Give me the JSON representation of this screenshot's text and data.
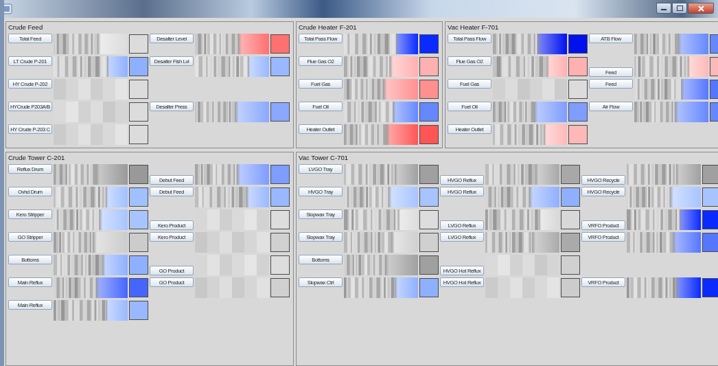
{
  "sections": [
    {
      "panels": [
        {
          "title": "Crude Feed",
          "rows": [
            {
              "cells": [
                {
                  "kind": "bars",
                  "label": "Total Feed",
                  "label_low": false,
                  "color": "#dcdcdc"
                },
                {
                  "kind": "bars",
                  "label": "Desalter Level",
                  "label_low": false,
                  "color": "#ff7070"
                }
              ]
            },
            {
              "cells": [
                {
                  "kind": "bars",
                  "label": "LT Crude P-201",
                  "label_low": false,
                  "color": "#8fb0ff"
                },
                {
                  "kind": "bars",
                  "label": "Desalter Fish Lvl",
                  "label_low": false,
                  "color": "#9ab8ff"
                }
              ]
            },
            {
              "cells": [
                {
                  "kind": "flat",
                  "label": "HY Crude P-202",
                  "label_low": false,
                  "color": "#dcdcdc"
                },
                {
                  "kind": "blank"
                }
              ]
            },
            {
              "cells": [
                {
                  "kind": "flat",
                  "label": "HYCrude P203A/B",
                  "label_low": false,
                  "color": "#dcdcdc"
                },
                {
                  "kind": "bars",
                  "label": "Desalter Press",
                  "label_low": false,
                  "color": "#8aa8ff"
                }
              ]
            },
            {
              "cells": [
                {
                  "kind": "flat",
                  "label": "HY Crude P-203 C",
                  "label_low": false,
                  "color": "#dcdcdc"
                },
                {
                  "kind": "blank"
                }
              ]
            }
          ]
        },
        {
          "title": "Crude Heater F-201",
          "rows": [
            {
              "cells": [
                {
                  "kind": "bars",
                  "label": "Total Pass Flow",
                  "label_low": false,
                  "color": "#0a2aff"
                }
              ]
            },
            {
              "cells": [
                {
                  "kind": "bars",
                  "label": "Flue Gas O2",
                  "label_low": false,
                  "color": "#ffb0b0"
                }
              ]
            },
            {
              "cells": [
                {
                  "kind": "bars",
                  "label": "Fuel Gas",
                  "label_low": false,
                  "color": "#ff9090"
                }
              ]
            },
            {
              "cells": [
                {
                  "kind": "bars",
                  "label": "Fuel Oil",
                  "label_low": false,
                  "color": "#6688ff"
                }
              ]
            },
            {
              "cells": [
                {
                  "kind": "bars",
                  "label": "Heater Outlet",
                  "label_low": false,
                  "color": "#ff5555"
                }
              ]
            }
          ]
        },
        {
          "title": "Vac Heater F-701",
          "rows": [
            {
              "cells": [
                {
                  "kind": "bars",
                  "label": "Total Pass Flow",
                  "label_low": false,
                  "color": "#0011ee"
                },
                {
                  "kind": "bars",
                  "label": "ATB Flow",
                  "label_low": false,
                  "color": "#6688ff"
                }
              ]
            },
            {
              "cells": [
                {
                  "kind": "bars",
                  "label": "Flue Gas O2",
                  "label_low": false,
                  "color": "#ffb0b0"
                },
                {
                  "kind": "bars",
                  "label": "Feed",
                  "label_low": true,
                  "color": "#ffb8b8"
                }
              ]
            },
            {
              "cells": [
                {
                  "kind": "flat",
                  "label": "Fuel Gas",
                  "label_low": false,
                  "color": "#dcdcdc"
                },
                {
                  "kind": "bars",
                  "label": "Feed",
                  "label_low": false,
                  "color": "#5577ff"
                }
              ]
            },
            {
              "cells": [
                {
                  "kind": "bars",
                  "label": "Fuel Oil",
                  "label_low": false,
                  "color": "#7f9dff"
                },
                {
                  "kind": "bars",
                  "label": "Air Flow",
                  "label_low": false,
                  "color": "#6688ff"
                }
              ]
            },
            {
              "cells": [
                {
                  "kind": "bars",
                  "label": "Heater Outlet",
                  "label_low": false,
                  "color": "#ffb8b8"
                },
                {
                  "kind": "blank"
                }
              ]
            }
          ]
        }
      ]
    },
    {
      "panels": [
        {
          "title": "Crude Tower C-201",
          "rows": [
            {
              "cells": [
                {
                  "kind": "bars",
                  "label": "Reflux Drum",
                  "label_low": false,
                  "color": "#999999"
                },
                {
                  "kind": "bars",
                  "label": "Debut Feed",
                  "label_low": true,
                  "color": "#7f9cff"
                }
              ]
            },
            {
              "cells": [
                {
                  "kind": "bars",
                  "label": "Ovhd Drum",
                  "label_low": false,
                  "color": "#a0c0ff"
                },
                {
                  "kind": "bars",
                  "label": "Debut Feed",
                  "label_low": false,
                  "color": "#9ab8ff"
                }
              ]
            },
            {
              "cells": [
                {
                  "kind": "bars",
                  "label": "Kero Stripper",
                  "label_low": false,
                  "color": "#a8c4ff"
                },
                {
                  "kind": "flat",
                  "label": "Kero Product",
                  "label_low": true,
                  "color": "#dddddd"
                }
              ]
            },
            {
              "cells": [
                {
                  "kind": "bars",
                  "label": "GO Stripper",
                  "label_low": false,
                  "color": "#cccccc"
                },
                {
                  "kind": "flat",
                  "label": "Kero Product",
                  "label_low": false,
                  "color": "#d0d0d0"
                }
              ]
            },
            {
              "cells": [
                {
                  "kind": "bars",
                  "label": "Bottoms",
                  "label_low": false,
                  "color": "#8fb0ff"
                },
                {
                  "kind": "flat",
                  "label": "GO Product",
                  "label_low": true,
                  "color": "#dddddd"
                }
              ]
            },
            {
              "cells": [
                {
                  "kind": "bars",
                  "label": "Main Reflux",
                  "label_low": false,
                  "color": "#4466ff"
                },
                {
                  "kind": "flat",
                  "label": "GO Product",
                  "label_low": false,
                  "color": "#d0d0d0"
                }
              ]
            },
            {
              "cells": [
                {
                  "kind": "bars",
                  "label": "Main Reflux",
                  "label_low": false,
                  "color": "#9ab8ff"
                },
                {
                  "kind": "blank"
                }
              ]
            }
          ]
        },
        {
          "title": "Vac Tower C-701",
          "rows": [
            {
              "cells": [
                {
                  "kind": "bars",
                  "label": "LVGO Tray",
                  "label_low": false,
                  "color": "#a0a0a0"
                },
                {
                  "kind": "bars",
                  "label": "HVGO Reflux",
                  "label_low": true,
                  "color": "#a8a8a8"
                },
                {
                  "kind": "bars",
                  "label": "HVGO Recycle",
                  "label_low": true,
                  "color": "#a0a0a0"
                }
              ]
            },
            {
              "cells": [
                {
                  "kind": "bars",
                  "label": "HVGO Tray",
                  "label_low": false,
                  "color": "#a8c4ff"
                },
                {
                  "kind": "bars",
                  "label": "HVGO Reflux",
                  "label_low": false,
                  "color": "#8fb0ff"
                },
                {
                  "kind": "bars",
                  "label": "HVGO Recycle",
                  "label_low": false,
                  "color": "#a8c4ff"
                }
              ]
            },
            {
              "cells": [
                {
                  "kind": "bars",
                  "label": "Slopwax Tray",
                  "label_low": false,
                  "color": "#dddddd"
                },
                {
                  "kind": "bars",
                  "label": "LVGO Reflux",
                  "label_low": true,
                  "color": "#d8d8d8"
                },
                {
                  "kind": "bars",
                  "label": "VRFO Product",
                  "label_low": true,
                  "color": "#0a2aff"
                }
              ]
            },
            {
              "cells": [
                {
                  "kind": "bars",
                  "label": "Slopwax Tray",
                  "label_low": false,
                  "color": "#d0d0d0"
                },
                {
                  "kind": "bars",
                  "label": "LVGO Reflux",
                  "label_low": false,
                  "color": "#aaaaaa"
                },
                {
                  "kind": "bars",
                  "label": "VRFO Product",
                  "label_low": false,
                  "color": "#5577ff"
                }
              ]
            },
            {
              "cells": [
                {
                  "kind": "bars",
                  "label": "Bottoms",
                  "label_low": false,
                  "color": "#a0a0a0"
                },
                {
                  "kind": "flat",
                  "label": "HVGO Hot Reflux",
                  "label_low": true,
                  "color": "#d0d0d0"
                },
                {
                  "kind": "blank"
                }
              ]
            },
            {
              "cells": [
                {
                  "kind": "bars",
                  "label": "Slopwax Ctrl",
                  "label_low": false,
                  "color": "#8fb0ff"
                },
                {
                  "kind": "flat",
                  "label": "HVGO Hot Reflux",
                  "label_low": false,
                  "color": "#cccccc"
                },
                {
                  "kind": "bars",
                  "label": "VRFO Product",
                  "label_low": false,
                  "color": "#0a2aff"
                }
              ]
            }
          ]
        }
      ]
    }
  ]
}
